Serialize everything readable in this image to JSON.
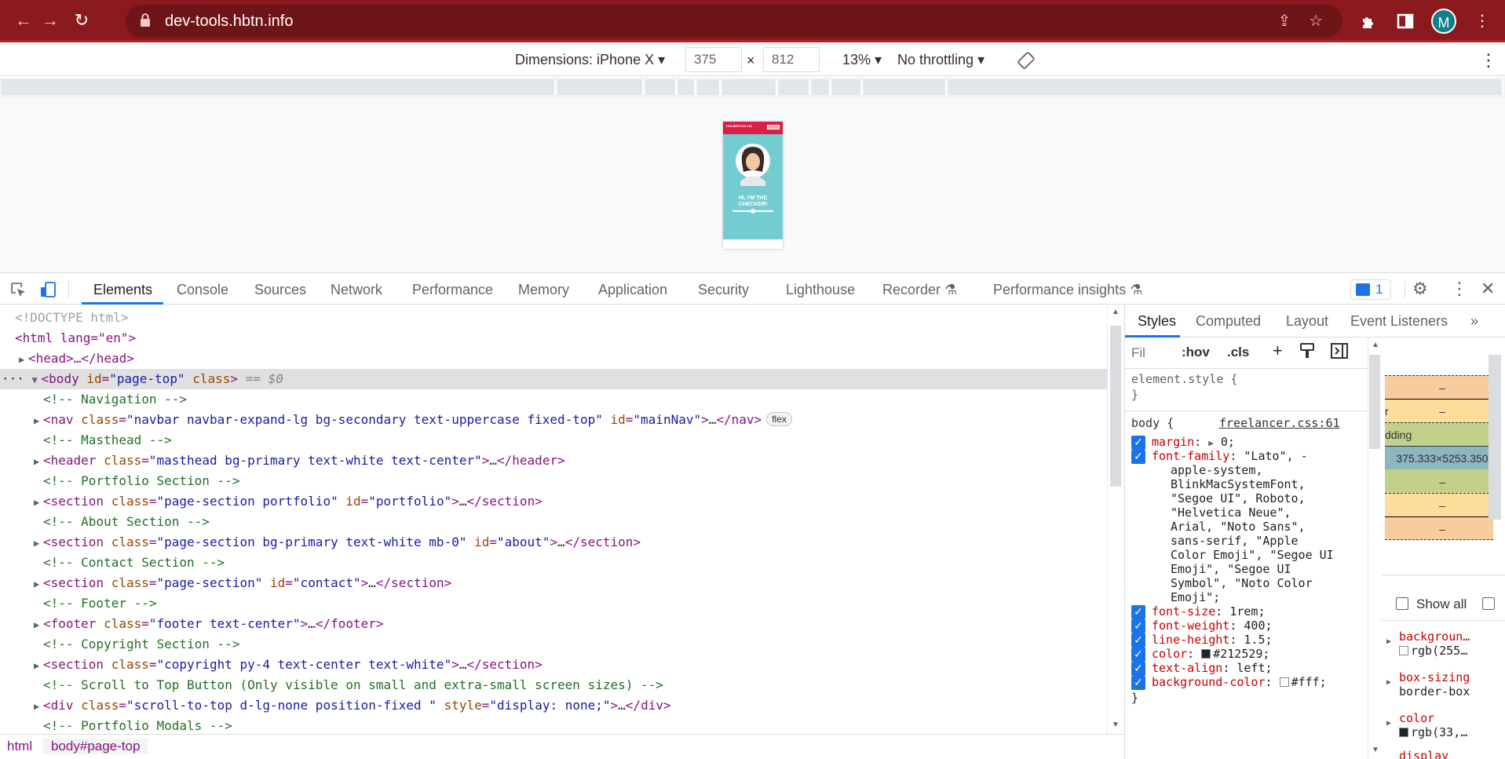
{
  "browser": {
    "url": "dev-tools.hbtn.info",
    "avatar_initial": "M",
    "colors": {
      "frame": "#8b1a1e",
      "omnibox": "#6e1518",
      "avatar": "#0f7f8c"
    }
  },
  "device_toolbar": {
    "dimensions_label": "Dimensions: iPhone X",
    "width_value": "375",
    "height_value": "812",
    "times": "×",
    "zoom": "13%",
    "throttling": "No throttling"
  },
  "preview": {
    "nav_text": "HOLBERTON 101",
    "hero_title_line1": "HI, I'M THE",
    "hero_title_line2": "CHECKER!"
  },
  "devtools": {
    "tabs": [
      "Elements",
      "Console",
      "Sources",
      "Network",
      "Performance",
      "Memory",
      "Application",
      "Security",
      "Lighthouse",
      "Recorder",
      "Performance insights"
    ],
    "active_tab": "Elements",
    "issues_count": "1"
  },
  "dom": {
    "doctype": "<!DOCTYPE html>",
    "html_open": "<html lang=\"en\">",
    "head": "<head>…</head>",
    "body_tag": "body",
    "body_attr_id": "id",
    "body_id_val": "\"page-top\"",
    "body_attr_class": "class",
    "body_eq": "== $0",
    "comments": {
      "navigation": "<!-- Navigation -->",
      "masthead": "<!-- Masthead -->",
      "portfolio": "<!-- Portfolio Section -->",
      "about": "<!-- About Section -->",
      "contact": "<!-- Contact Section -->",
      "footer": "<!-- Footer -->",
      "copyright": "<!-- Copyright Section -->",
      "scroll": "<!-- Scroll to Top Button (Only visible on small and extra-small screen sizes) -->",
      "modals": "<!-- Portfolio Modals -->"
    },
    "nav": {
      "cls": "\"navbar navbar-expand-lg bg-secondary text-uppercase fixed-top\"",
      "id": "\"mainNav\"",
      "badge": "flex"
    },
    "header": {
      "cls": "\"masthead bg-primary text-white text-center\""
    },
    "portfolio": {
      "cls": "\"page-section portfolio\"",
      "id": "\"portfolio\""
    },
    "about": {
      "cls": "\"page-section bg-primary text-white mb-0\"",
      "id": "\"about\""
    },
    "contact": {
      "cls": "\"page-section\"",
      "id": "\"contact\""
    },
    "footer": {
      "cls": "\"footer text-center\""
    },
    "copyright": {
      "cls": "\"copyright py-4 text-center text-white\""
    },
    "scroll_div": {
      "cls": "\"scroll-to-top d-lg-none position-fixed \"",
      "style": "\"display: none;\""
    }
  },
  "breadcrumb": [
    "html",
    "body#page-top"
  ],
  "styles": {
    "tabs": [
      "Styles",
      "Computed",
      "Layout",
      "Event Listeners"
    ],
    "filter_placeholder": "Fil",
    "hov": ":hov",
    "cls": ".cls",
    "element_style": "element.style {",
    "close_brace": "}",
    "body_selector": "body {",
    "source": "freelancer.css:61",
    "props": [
      {
        "name": "margin",
        "value": "0;"
      },
      {
        "name": "font-family",
        "value": "\"Lato\", -"
      },
      {
        "name": "font-size",
        "value": "1rem;"
      },
      {
        "name": "font-weight",
        "value": "400;"
      },
      {
        "name": "line-height",
        "value": "1.5;"
      },
      {
        "name": "color",
        "value": "#212529;"
      },
      {
        "name": "text-align",
        "value": "left;"
      },
      {
        "name": "background-color",
        "value": "#fff;"
      }
    ],
    "font_family_cont": [
      "apple-system,",
      "BlinkMacSystemFont,",
      "\"Segoe UI\", Roboto,",
      "\"Helvetica Neue\",",
      "Arial, \"Noto Sans\",",
      "sans-serif, \"Apple",
      "Color Emoji\", \"Segoe UI",
      "Emoji\", \"Segoe UI",
      "Symbol\", \"Noto Color",
      "Emoji\";"
    ]
  },
  "computed": {
    "box_labels": [
      "–",
      "r",
      "–",
      "dding",
      "–",
      "375.333×5253.350",
      "–",
      "–",
      "–"
    ],
    "show_all": "Show all",
    "props": [
      {
        "name": "backgroun…",
        "value": "rgb(255…"
      },
      {
        "name": "box-sizing",
        "value": "border-box"
      },
      {
        "name": "color",
        "value": "rgb(33,…"
      },
      {
        "name": "display",
        "value": ""
      }
    ]
  }
}
